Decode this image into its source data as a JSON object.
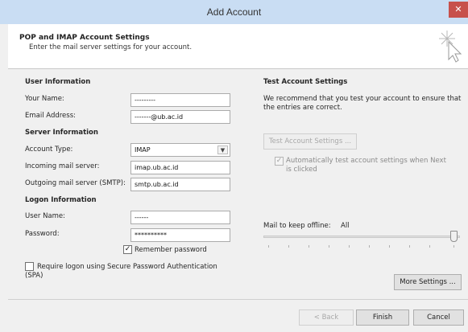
{
  "window": {
    "title": "Add Account",
    "close_glyph": "✕"
  },
  "header": {
    "title": "POP and IMAP Account Settings",
    "subtitle": "Enter the mail server settings for your account.",
    "icon": "cursor-sparkle-icon"
  },
  "user_info": {
    "heading": "User Information",
    "your_name_label": "Your Name:",
    "your_name_value": "---------",
    "email_label": "Email Address:",
    "email_value": "-------@ub.ac.id"
  },
  "server_info": {
    "heading": "Server Information",
    "account_type_label": "Account Type:",
    "account_type_value": "IMAP",
    "incoming_label": "Incoming mail server:",
    "incoming_value": "imap.ub.ac.id",
    "outgoing_label": "Outgoing mail server (SMTP):",
    "outgoing_value": "smtp.ub.ac.id"
  },
  "logon_info": {
    "heading": "Logon Information",
    "username_label": "User Name:",
    "username_value": "------",
    "password_label": "Password:",
    "password_value": "**********",
    "remember_label": "Remember password",
    "remember_checked": true,
    "spa_label_line1": "Require logon using Secure Password Authentication",
    "spa_label_line2": "(SPA)",
    "spa_checked": false
  },
  "test_settings": {
    "heading": "Test Account Settings",
    "description_line1": "We recommend that you test your account to ensure that",
    "description_line2": "the entries are correct.",
    "test_button": "Test Account Settings ...",
    "auto_test_line1": "Automatically test account settings when Next",
    "auto_test_line2": "is clicked",
    "auto_test_checked": true
  },
  "offline": {
    "label": "Mail to keep offline:",
    "value": "All"
  },
  "buttons": {
    "more_settings": "More Settings ...",
    "back": "< Back",
    "finish": "Finish",
    "cancel": "Cancel"
  },
  "colors": {
    "titlebar": "#c9ddf3",
    "close": "#c7504b",
    "dialog_bg": "#f0f0f0"
  }
}
